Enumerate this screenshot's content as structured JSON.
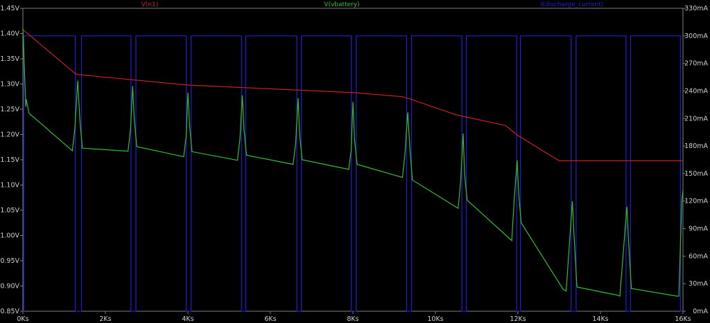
{
  "chart_data": {
    "type": "line",
    "background": "#000000",
    "frame_color": "#808080",
    "x_axis": {
      "range": [
        0,
        16000
      ],
      "ticks": [
        0,
        2000,
        4000,
        6000,
        8000,
        10000,
        12000,
        14000,
        16000
      ],
      "tick_labels": [
        "0Ks",
        "2Ks",
        "4Ks",
        "6Ks",
        "8Ks",
        "10Ks",
        "12Ks",
        "14Ks",
        "16Ks"
      ]
    },
    "y_left": {
      "range": [
        0.85,
        1.45
      ],
      "ticks": [
        0.85,
        0.9,
        0.95,
        1.0,
        1.05,
        1.1,
        1.15,
        1.2,
        1.25,
        1.3,
        1.35,
        1.4,
        1.45
      ],
      "tick_labels": [
        "0.85V",
        "0.90V",
        "0.95V",
        "1.00V",
        "1.05V",
        "1.10V",
        "1.15V",
        "1.20V",
        "1.25V",
        "1.30V",
        "1.35V",
        "1.40V",
        "1.45V"
      ]
    },
    "y_right": {
      "range": [
        0,
        330
      ],
      "ticks": [
        0,
        30,
        60,
        90,
        120,
        150,
        180,
        210,
        240,
        270,
        300,
        330
      ],
      "tick_labels": [
        "0mA",
        "30mA",
        "60mA",
        "90mA",
        "120mA",
        "150mA",
        "180mA",
        "210mA",
        "240mA",
        "270mA",
        "300mA",
        "330mA"
      ]
    },
    "legend": [
      {
        "label": "V(n1)",
        "color": "#cc2020"
      },
      {
        "label": "V(vbattery)",
        "color": "#30c030"
      },
      {
        "label": "I(discharge_current)",
        "color": "#2020d0"
      }
    ],
    "series": [
      {
        "name": "V(n1)",
        "axis": "left",
        "color": "#cc2020",
        "x": [
          0,
          1250,
          1300,
          4000,
          8000,
          9200,
          9400,
          10500,
          11700,
          12000,
          13000,
          16000
        ],
        "y": [
          1.408,
          1.322,
          1.319,
          1.298,
          1.283,
          1.275,
          1.27,
          1.239,
          1.218,
          1.198,
          1.148,
          1.148
        ]
      },
      {
        "name": "V(vbattery)",
        "axis": "left",
        "color": "#30c030",
        "x": [
          0,
          20,
          70,
          80,
          150,
          1200,
          1260,
          1330,
          1380,
          1440,
          2550,
          2610,
          2660,
          2700,
          2760,
          3900,
          3960,
          4000,
          4040,
          4100,
          5200,
          5260,
          5320,
          5360,
          5420,
          6550,
          6610,
          6670,
          6710,
          6770,
          7900,
          7960,
          8000,
          8040,
          8100,
          9200,
          9260,
          9330,
          9380,
          9440,
          10550,
          10610,
          10670,
          10710,
          10770,
          11850,
          11910,
          11980,
          12020,
          12080,
          13100,
          13170,
          13320,
          13360,
          13430,
          14400,
          14470,
          14640,
          14680,
          14750,
          15850,
          15900,
          15970,
          16000
        ],
        "y": [
          1.41,
          1.365,
          1.255,
          1.27,
          1.242,
          1.168,
          1.212,
          1.307,
          1.232,
          1.173,
          1.167,
          1.212,
          1.296,
          1.23,
          1.176,
          1.156,
          1.198,
          1.283,
          1.22,
          1.166,
          1.149,
          1.19,
          1.278,
          1.21,
          1.159,
          1.141,
          1.18,
          1.272,
          1.2,
          1.15,
          1.131,
          1.17,
          1.265,
          1.19,
          1.141,
          1.115,
          1.16,
          1.244,
          1.175,
          1.11,
          1.054,
          1.105,
          1.202,
          1.12,
          1.07,
          0.99,
          1.07,
          1.149,
          1.08,
          1.025,
          0.893,
          0.89,
          1.068,
          1.0,
          0.898,
          0.882,
          0.88,
          1.057,
          0.99,
          0.895,
          0.88,
          0.88,
          1.065,
          1.09
        ]
      },
      {
        "name": "I(discharge_current)",
        "axis": "right",
        "color": "#2020d0",
        "pulse_high": 300,
        "pulse_low": 0,
        "off_windows": [
          [
            0,
            20
          ],
          [
            1270,
            1420
          ],
          [
            2620,
            2740
          ],
          [
            3960,
            4080
          ],
          [
            5300,
            5400
          ],
          [
            6640,
            6750
          ],
          [
            7960,
            8080
          ],
          [
            9300,
            9420
          ],
          [
            10640,
            10750
          ],
          [
            11970,
            12060
          ],
          [
            13290,
            13410
          ],
          [
            14620,
            14730
          ],
          [
            15940,
            16000
          ]
        ]
      }
    ]
  }
}
